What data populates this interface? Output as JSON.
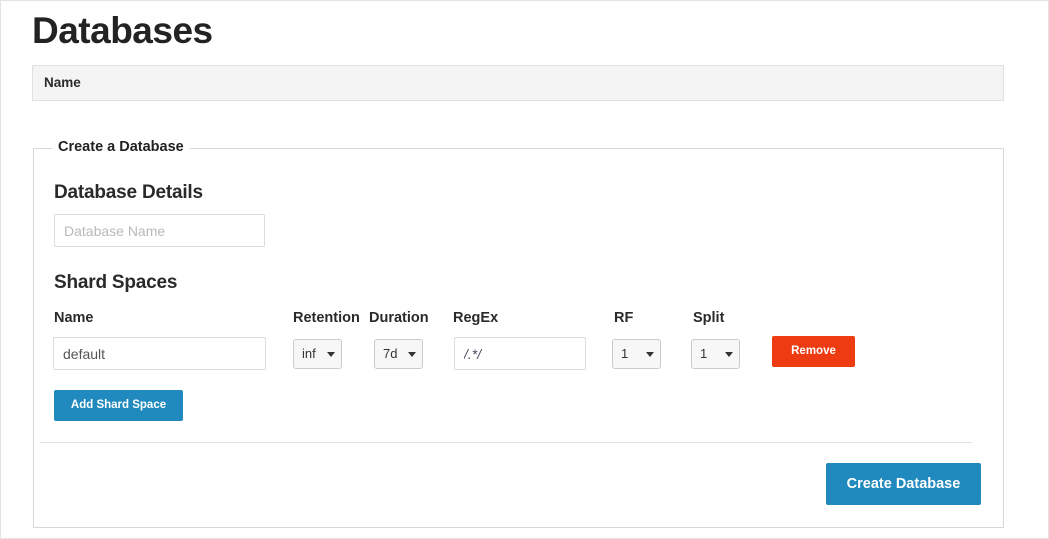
{
  "page": {
    "title": "Databases"
  },
  "database_list": {
    "column_header": "Name",
    "rows": []
  },
  "create_panel": {
    "legend": "Create a Database",
    "database_details": {
      "heading": "Database Details",
      "name_field": {
        "value": "",
        "placeholder": "Database Name"
      }
    },
    "shard_spaces": {
      "heading": "Shard Spaces",
      "columns": [
        "Name",
        "Retention",
        "Duration",
        "RegEx",
        "RF",
        "Split"
      ],
      "rows": [
        {
          "name": "default",
          "retention": "inf",
          "duration": "7d",
          "regex": "/.*/",
          "rf": "1",
          "split": "1",
          "remove_label": "Remove"
        }
      ],
      "add_label": "Add Shard Space"
    },
    "submit_label": "Create Database"
  },
  "colors": {
    "primary_blue": "#2089bd",
    "danger_red": "#ee3b11",
    "header_gray": "#f4f4f4",
    "border_gray": "#d8d8d8"
  },
  "icons": {
    "dropdown_caret": "chevron-down-icon"
  }
}
